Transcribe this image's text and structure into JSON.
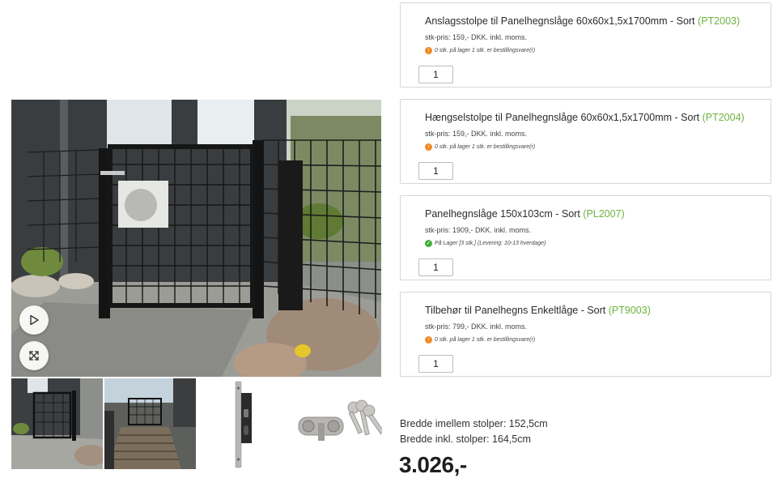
{
  "products": [
    {
      "name": "Anslagsstolpe til Panelhegnslåge 60x60x1,5x1700mm - Sort",
      "code": "(PT2003)",
      "price": "stk-pris: 159,- DKK. inkl. moms.",
      "stock_status": "warning",
      "stock": "0 stk. på lager 1 stk. er bestillingsvare(r)",
      "quantity": "1"
    },
    {
      "name": "Hængselstolpe til Panelhegnslåge 60x60x1,5x1700mm - Sort",
      "code": "(PT2004)",
      "price": "stk-pris: 159,- DKK. inkl. moms.",
      "stock_status": "warning",
      "stock": "0 stk. på lager 1 stk. er bestillingsvare(r)",
      "quantity": "1"
    },
    {
      "name": "Panelhegnslåge 150x103cm - Sort",
      "code": "(PL2007)",
      "price": "stk-pris: 1909,- DKK. inkl. moms.",
      "stock_status": "ok",
      "stock": "På Lager [3 stk.] (Levering: 10-13 hverdage)",
      "quantity": "1"
    },
    {
      "name": "Tilbehør til Panelhegns Enkeltlåge - Sort",
      "code": "(PT9003)",
      "price": "stk-pris: 799,- DKK. inkl. moms.",
      "stock_status": "warning",
      "stock": "0 stk. på lager 1 stk. er bestillingsvare(r)",
      "quantity": "1"
    }
  ],
  "summary": {
    "width_between_posts": "Bredde imellem stolper: 152,5cm",
    "width_incl_posts": "Bredde inkl. stolper: 164,5cm",
    "total": "3.026,-"
  },
  "icons": {
    "play": "play-icon",
    "expand": "expand-icon",
    "warning": "warning-arrow-icon",
    "ok": "check-icon"
  },
  "colors": {
    "product_code": "#6cb33f",
    "warning": "#f08a24",
    "ok": "#3fae3a",
    "card_border": "#d6d6d6"
  }
}
